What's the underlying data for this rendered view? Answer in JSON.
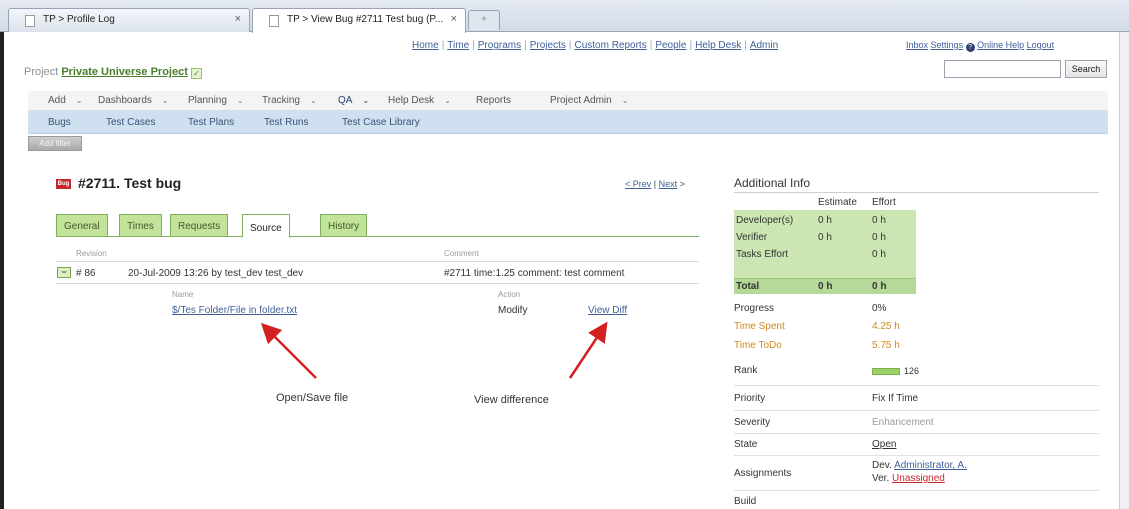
{
  "browser": {
    "tabs": [
      {
        "title": "TP > Profile Log",
        "close": "×"
      },
      {
        "title": "TP > View Bug #2711 Test bug (P...",
        "close": "×"
      }
    ],
    "new_tab": "+"
  },
  "toplinks": {
    "home": "Home",
    "time": "Time",
    "programs": "Programs",
    "projects": "Projects",
    "custom_reports": "Custom Reports",
    "people": "People",
    "help_desk": "Help Desk",
    "admin": "Admin",
    "sep": "|"
  },
  "rightlinks": {
    "inbox": "Inbox",
    "settings": "Settings",
    "online_help": "Online Help",
    "logout": "Logout",
    "help_glyph": "?"
  },
  "search": {
    "value": "",
    "button": "Search"
  },
  "project": {
    "prefix": "Project",
    "name": "Private Universe Project",
    "check": "✓"
  },
  "mainnav": {
    "items": [
      {
        "label": "Add",
        "dd": "⌄"
      },
      {
        "label": "Dashboards",
        "dd": "⌄"
      },
      {
        "label": "Planning",
        "dd": "⌄"
      },
      {
        "label": "Tracking",
        "dd": "⌄"
      },
      {
        "label": "QA",
        "dd": "⌄"
      },
      {
        "label": "Help Desk",
        "dd": "⌄"
      },
      {
        "label": "Reports",
        "dd": ""
      },
      {
        "label": "Project Admin",
        "dd": "⌄"
      }
    ]
  },
  "subnav": {
    "items": [
      "Bugs",
      "Test Cases",
      "Test Plans",
      "Test Runs",
      "Test Case Library"
    ]
  },
  "add_filter": "Add filter",
  "bug": {
    "badge": "Bug",
    "title": "#2711. Test bug",
    "prev": "< Prev",
    "pipe": "|",
    "next": "Next",
    "next_arrow": " >"
  },
  "tabs": [
    "General",
    "Times",
    "Requests",
    "Source",
    "History"
  ],
  "source": {
    "revision_header": "Revision",
    "comment_header": "Comment",
    "toggle": "−",
    "revision": "# 86",
    "commit": "20-Jul-2009 13:26 by test_dev test_dev",
    "comment": "#2711 time:1.25 comment: test comment",
    "name_header": "Name",
    "action_header": "Action",
    "file": "$/Tes Folder/File in folder.txt",
    "action": "Modify",
    "view_diff": "View Diff"
  },
  "annotations": {
    "open_save": "Open/Save file",
    "view_difference": "View difference"
  },
  "additional_info": {
    "title": "Additional Info",
    "estimate": "Estimate",
    "effort": "Effort",
    "rows": [
      {
        "label": "Developer(s)",
        "estimate": "0 h",
        "effort": "0 h"
      },
      {
        "label": "Verifier",
        "estimate": "0 h",
        "effort": "0 h"
      },
      {
        "label": "Tasks Effort",
        "estimate": "",
        "effort": "0 h"
      },
      {
        "label": "Total",
        "estimate": "0 h",
        "effort": "0 h"
      }
    ],
    "progress_label": "Progress",
    "progress": "0%",
    "time_spent_label": "Time Spent",
    "time_spent": "4.25 h",
    "time_todo_label": "Time ToDo",
    "time_todo": "5.75 h",
    "rank_label": "Rank",
    "rank": "126",
    "priority_label": "Priority",
    "priority": "Fix If Time",
    "severity_label": "Severity",
    "severity": "Enhancement",
    "state_label": "State",
    "state": "Open",
    "assignments_label": "Assignments",
    "dev_prefix": "Dev.",
    "dev": "Administrator, A.",
    "ver_prefix": "Ver.",
    "ver": "Unassigned",
    "build_label": "Build"
  },
  "colors": {
    "accent_green": "#c3e39a",
    "link_blue": "#3f5f9a",
    "subnav_blue": "#cfe1f1",
    "bug_red": "#c8262c",
    "time_orange": "#cf8a1d"
  }
}
